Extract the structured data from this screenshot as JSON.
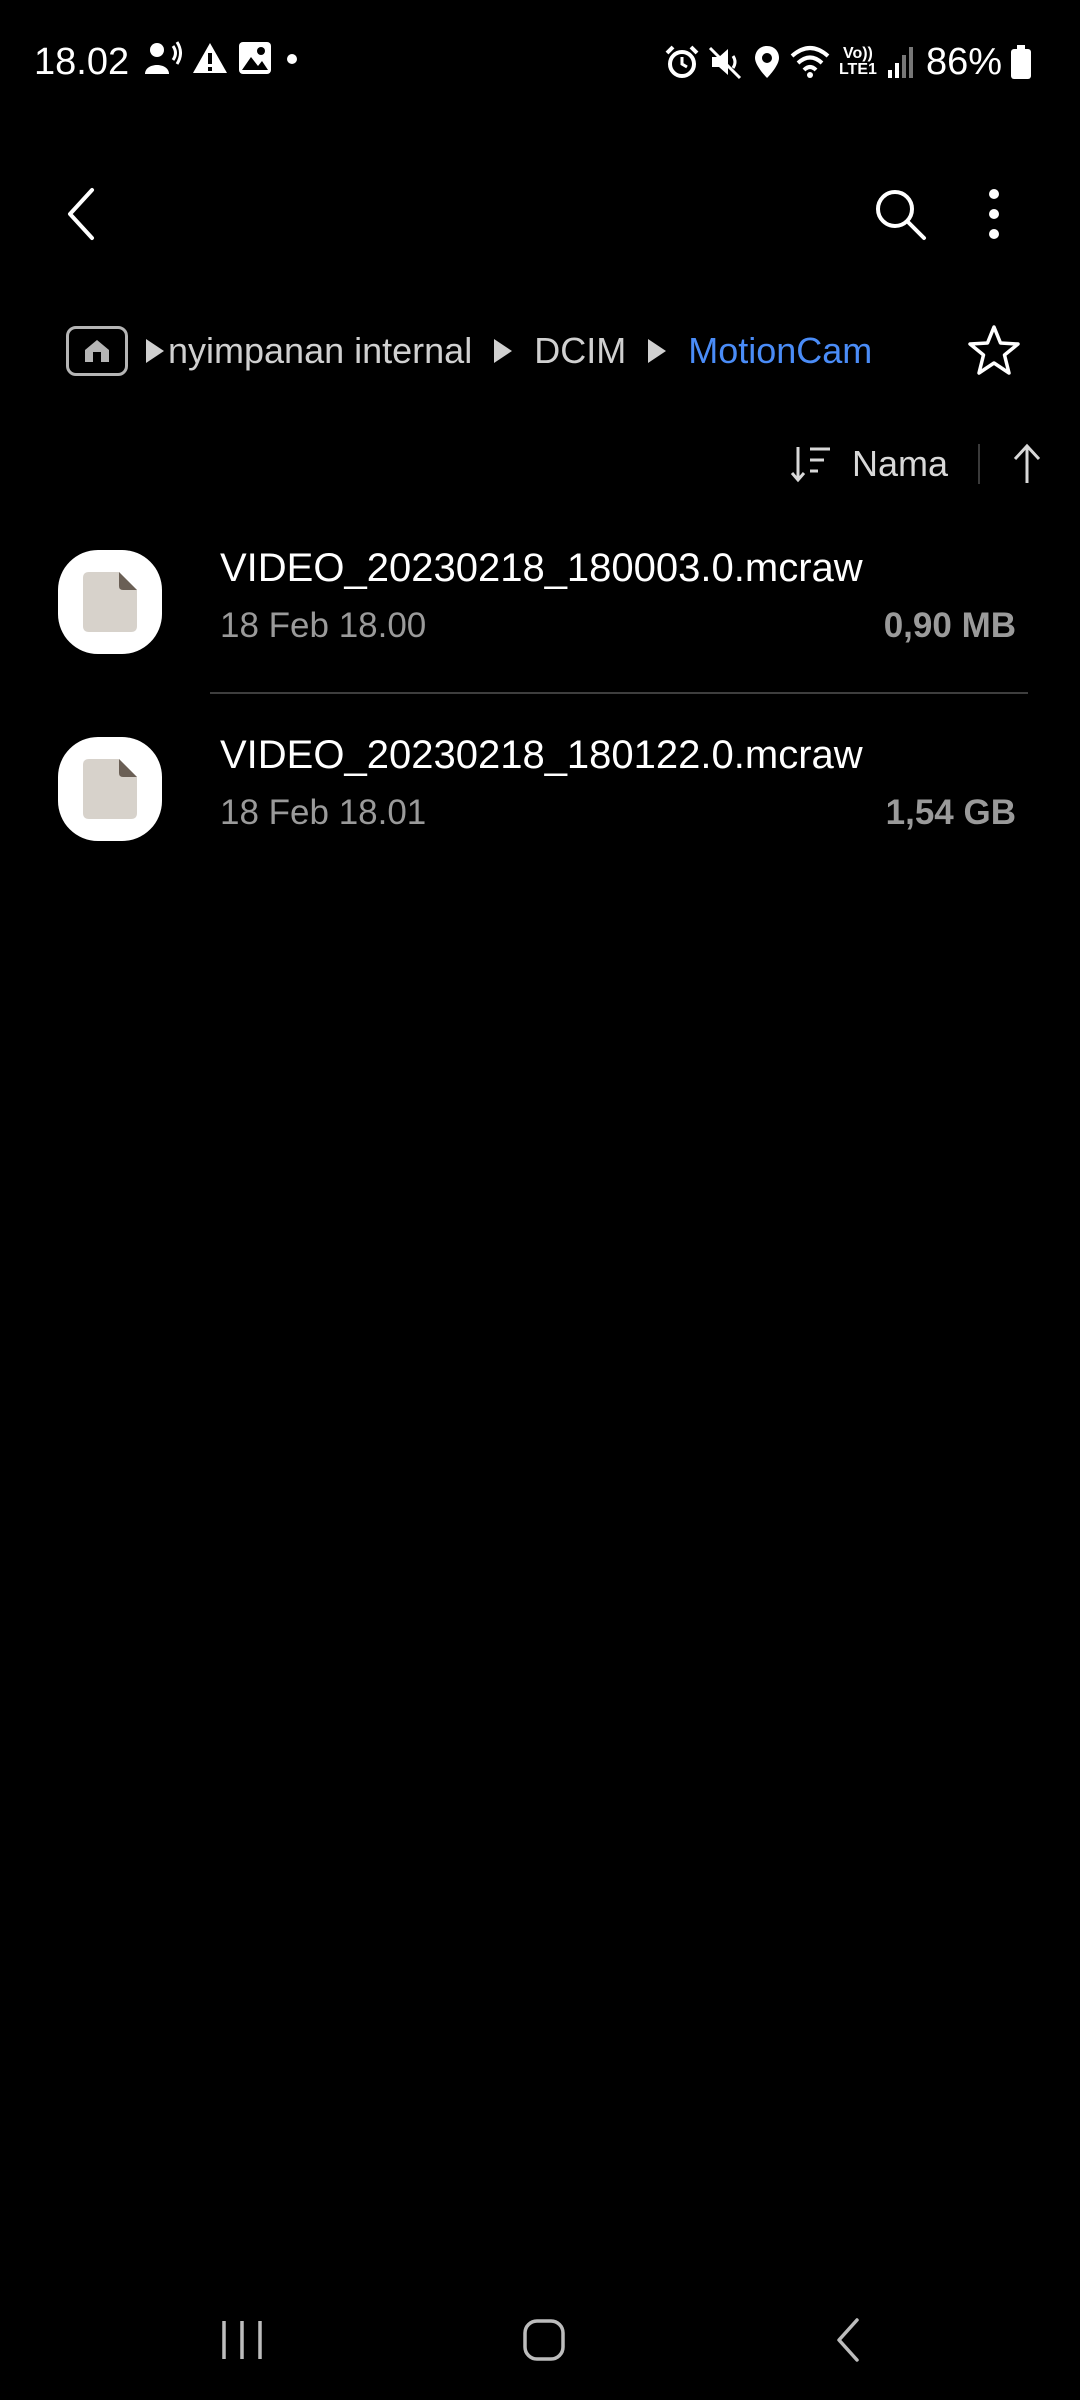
{
  "status_bar": {
    "time": "18.02",
    "battery": "86%",
    "left_icons": [
      "voice-call-icon",
      "warning-icon",
      "image-icon",
      "dot-icon"
    ],
    "right_icons": [
      "alarm-icon",
      "mute-icon",
      "location-icon",
      "wifi-icon",
      "volte-icon",
      "signal-icon",
      "battery-icon"
    ],
    "volte_label": "Vo)) LTE1"
  },
  "toolbar": {
    "back_icon": "chevron-left-icon",
    "search_icon": "search-icon",
    "more_icon": "more-vert-icon"
  },
  "breadcrumb": {
    "home_icon": "folder-home-icon",
    "items": [
      "nyimpanan internal",
      "DCIM",
      "MotionCam"
    ],
    "favorite_icon": "star-icon"
  },
  "sort": {
    "label": "Nama",
    "sort_icon": "sort-lines-icon",
    "direction_icon": "arrow-up-icon"
  },
  "files": [
    {
      "name": "VIDEO_20230218_180003.0.mcraw",
      "date": "18 Feb 18.00",
      "size": "0,90 MB",
      "icon": "file-icon"
    },
    {
      "name": "VIDEO_20230218_180122.0.mcraw",
      "date": "18 Feb 18.01",
      "size": "1,54 GB",
      "icon": "file-icon"
    }
  ],
  "nav_bar": {
    "recents_icon": "recents-icon",
    "home_icon": "home-icon",
    "back_icon": "back-icon"
  },
  "colors": {
    "background": "#000000",
    "accent": "#4a8cf7",
    "secondary_text": "#9a9a9a"
  }
}
